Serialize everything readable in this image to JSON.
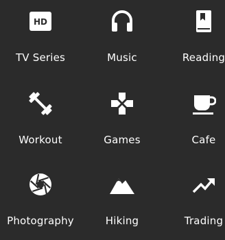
{
  "background_color": "#2b2b2b",
  "text_color": "#ffffff",
  "grid": {
    "rows": [
      [
        {
          "label": "TV Series",
          "icon": "hd-icon"
        },
        {
          "label": "Music",
          "icon": "headphones-icon"
        },
        {
          "label": "Reading",
          "icon": "book-icon"
        }
      ],
      [
        {
          "label": "Workout",
          "icon": "dumbbell-icon"
        },
        {
          "label": "Games",
          "icon": "gamepad-icon"
        },
        {
          "label": "Cafe",
          "icon": "coffee-cup-icon"
        }
      ],
      [
        {
          "label": "Photography",
          "icon": "camera-aperture-icon"
        },
        {
          "label": "Hiking",
          "icon": "mountains-icon"
        },
        {
          "label": "Trading",
          "icon": "trending-up-icon"
        }
      ]
    ]
  }
}
